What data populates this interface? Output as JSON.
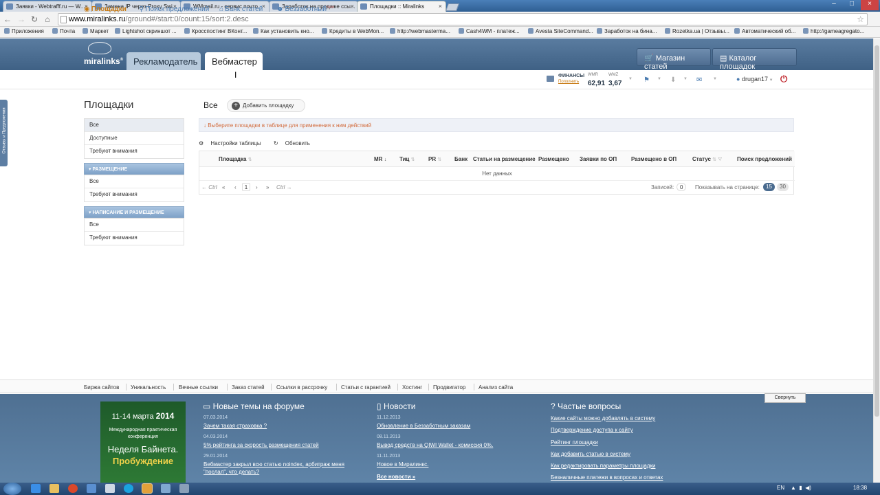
{
  "browser": {
    "tabs": [
      {
        "title": "Заявки - Webtrafff.ru — W..."
      },
      {
        "title": "Замена IP через Proxy Swi..."
      },
      {
        "title": "WMmail.ru - сервис почто..."
      },
      {
        "title": "Заработок на продаже ссы..."
      },
      {
        "title": "Площадки :: Miralinks"
      }
    ],
    "url_domain": "www.miralinks.ru",
    "url_path": "/ground#/start:0/count:15/sort:2.desc",
    "bookmarks": [
      "Приложения",
      "Почта",
      "Маркет",
      "Lightshot скриншот ...",
      "Кросспостинг ВКонт...",
      "Как установить кно...",
      "Кредиты в WebMon...",
      "http://webmasterma...",
      "Cash4WM - платеж...",
      "Avesta SiteCommand...",
      "Заработок на бина...",
      "Rozetka.ua | Отзывы...",
      "Автоматический об...",
      "http://gameagregato..."
    ]
  },
  "header": {
    "logo_text": "miralinks",
    "logo_sup": "®",
    "tab_advertiser": "Рекламодатель",
    "tab_webmaster": "Вебмастер",
    "shop_button": "Магазин статей",
    "catalog_button": "Каталог площадок"
  },
  "subnav": {
    "items": [
      "Площадки",
      "Поиск предложений",
      "Банк статей",
      "Беззаботный"
    ],
    "new_badge": "new",
    "finance_label": "ФИНАНСЫ",
    "finance_link": "Пополнить",
    "wmr_label": "WMR",
    "wmr_value": "62,91",
    "wmz_label": "WMZ",
    "wmz_value": "3,67",
    "username": "drugan17"
  },
  "side_widget": "Отзывы и Предложения",
  "left": {
    "title": "Площадки",
    "top_items": [
      "Все",
      "Доступные",
      "Требуют внимания"
    ],
    "section1": "РАЗМЕЩЕНИЕ",
    "section1_items": [
      "Все",
      "Требуют внимания"
    ],
    "section2": "НАПИСАНИЕ И РАЗМЕЩЕНИЕ",
    "section2_items": [
      "Все",
      "Требуют внимания"
    ]
  },
  "main": {
    "filter_label": "Все",
    "add_button": "Добавить площадку",
    "notice": "↓ Выберите площадки в таблице для применения к ним действий",
    "table_settings": "Настройки таблицы",
    "refresh": "Обновить",
    "columns": [
      "Площадка",
      "MR",
      "Тиц",
      "PR",
      "Банк",
      "Статьи на размещение",
      "Размещено",
      "Заявки по ОП",
      "Размещено в ОП",
      "Статус",
      "Поиск предложений"
    ],
    "no_data": "Нет данных",
    "pager": {
      "prev_ctrl": "← Ctrl",
      "first": "«",
      "prev": "‹",
      "page": "1",
      "next": "›",
      "last": "»",
      "next_ctrl": "Ctrl →",
      "records_label": "Записей:",
      "records_value": "0",
      "per_page_label": "Показывать на странице:",
      "per_page_15": "15",
      "per_page_30": "30"
    }
  },
  "bottom_nav": [
    "Биржа сайтов",
    "Уникальность",
    "Вечные ссылки",
    "Заказ статей",
    "Ссылки в рассрочку",
    "Статьи с гарантией",
    "Хостинг",
    "Продвигатор",
    "Анализ сайта"
  ],
  "footer": {
    "collapse": "Свернуть",
    "banner": {
      "dates": "11-14 марта",
      "year": "2014",
      "conf": "Международная практическая конференция",
      "name": "Неделя Байнета.",
      "sub": "Пробуждение"
    },
    "forum_title": "Новые темы на форуме",
    "forum": [
      {
        "date": "07.03.2014",
        "text": "Зачем такая страховка ?"
      },
      {
        "date": "04.03.2014",
        "text": "5% рейтинга за скорость размещения статей"
      },
      {
        "date": "29.01.2014",
        "text": "Вебмастер закрыл всю статью noindex, арбитраж меня"
      },
      {
        "date": "",
        "text": "\"послал\", что делать?"
      }
    ],
    "news_title": "Новости",
    "news": [
      {
        "date": "11.12.2013",
        "text": "Обновление в Беззаботным заказам"
      },
      {
        "date": "08.11.2013",
        "text": "Вывод средств на QIWI Wallet - комиссия 0%."
      },
      {
        "date": "11.11.2013",
        "text": "Новое в Миралинкс."
      }
    ],
    "all_news": "Все новости »",
    "faq_title": "Частые вопросы",
    "faq": [
      "Какие сайты можно добавлять в систему",
      "Подтверждение доступа к сайту",
      "Рейтинг площадки",
      "Как добавить статью в систему",
      "Как редактировать параметры площадки",
      "Безналичные платежи в вопросах и ответах"
    ]
  },
  "taskbar": {
    "lang": "EN",
    "time": "18:38"
  }
}
